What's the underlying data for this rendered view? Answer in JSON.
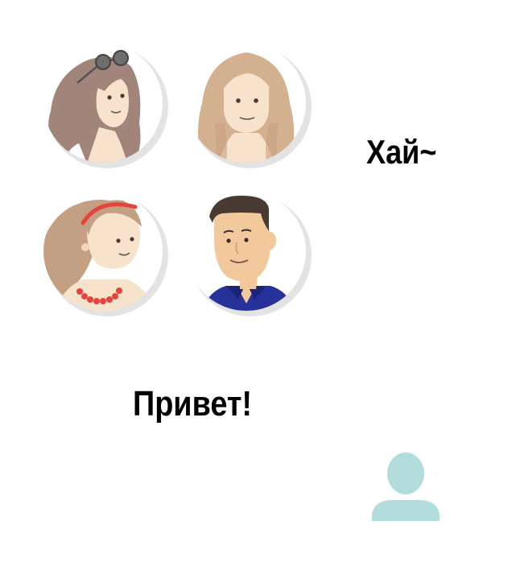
{
  "greetings": {
    "hi": "Хай~",
    "privet": "Привет!"
  },
  "avatars": [
    {
      "icon": "woman-sunglasses-avatar-icon"
    },
    {
      "icon": "woman-blonde-avatar-icon"
    },
    {
      "icon": "woman-headband-necklace-avatar-icon"
    },
    {
      "icon": "man-blue-shirt-avatar-icon"
    }
  ],
  "user_icon": {
    "icon": "user-silhouette-icon",
    "color": "#b3dcdc"
  },
  "colors": {
    "avatar_shadow": "#e3e3e3",
    "skin": "#f7e2cc",
    "hair_brown": "#a2857a",
    "hair_blonde": "#d3b090",
    "accent_red": "#e2453e",
    "shirt_blue": "#27319a"
  }
}
